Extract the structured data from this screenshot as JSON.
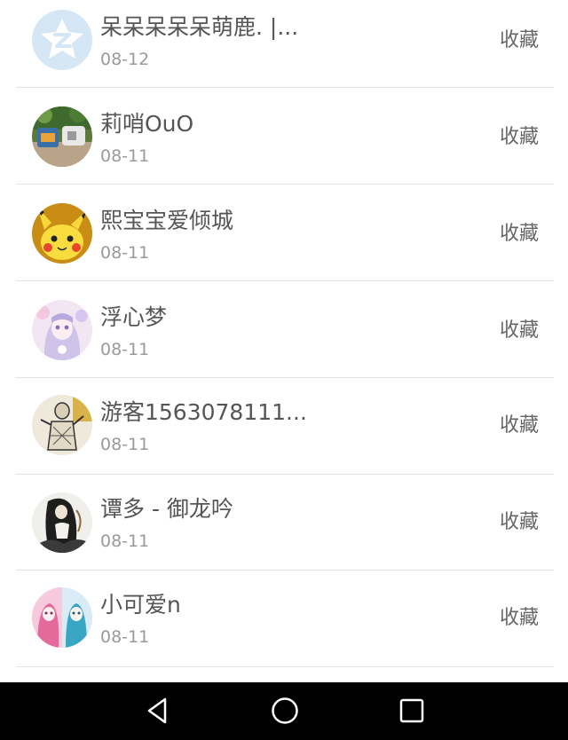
{
  "list": {
    "items": [
      {
        "name": "呆呆呆呆呆萌鹿. |...",
        "date": "08-12",
        "action": "收藏",
        "avatar": "qq-logo-avatar"
      },
      {
        "name": "莉哨OuO",
        "date": "08-11",
        "action": "收藏",
        "avatar": "photo-avatar"
      },
      {
        "name": "熙宝宝爱倾城",
        "date": "08-11",
        "action": "收藏",
        "avatar": "pikachu-avatar"
      },
      {
        "name": "浮心梦",
        "date": "08-11",
        "action": "收藏",
        "avatar": "anime-girl-avatar"
      },
      {
        "name": "游客1563078111...",
        "date": "08-11",
        "action": "收藏",
        "avatar": "sketch-avatar"
      },
      {
        "name": "谭多 - 御龙吟",
        "date": "08-11",
        "action": "收藏",
        "avatar": "ink-figure-avatar"
      },
      {
        "name": "小可爱n",
        "date": "08-11",
        "action": "收藏",
        "avatar": "anime-pair-avatar"
      }
    ]
  },
  "navbar": {
    "back_icon": "back-triangle-icon",
    "home_icon": "home-circle-icon",
    "recents_icon": "recents-square-icon"
  }
}
